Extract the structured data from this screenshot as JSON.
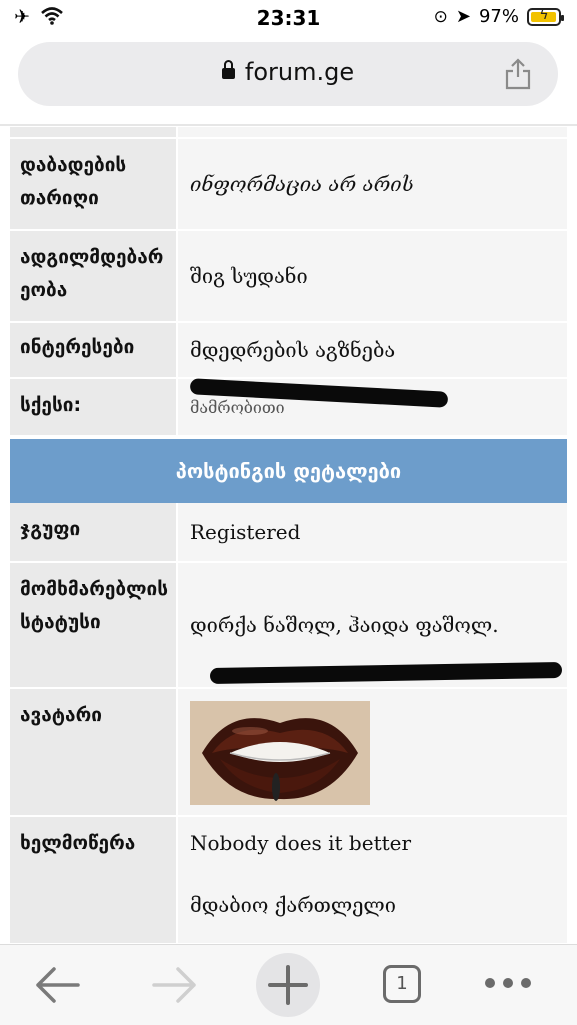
{
  "status_bar": {
    "time": "23:31",
    "battery": "97%",
    "battery_level": 0.97
  },
  "browser": {
    "url": "forum.ge"
  },
  "profile": {
    "birth_date": {
      "label": "დაბადების თარიღი",
      "value": "ინფორმაცია არ არის"
    },
    "location": {
      "label": "ადგილმდებარეობა",
      "value": "შიგ სუდანი"
    },
    "interests": {
      "label": "ინტერესები",
      "value": "მდედრების აგზნება"
    },
    "gender": {
      "label": "სქესი:",
      "value": "მამრობითი"
    }
  },
  "posting_details": {
    "header": "პოსტინგის დეტალები",
    "group": {
      "label": "ჯგუფი",
      "value": "Registered"
    },
    "user_status": {
      "label": "მომხმარებლის სტატუსი",
      "value": "დირქა ნაშოლ, ჰაიდა ფაშოლ."
    },
    "avatar": {
      "label": "ავატარი"
    },
    "signature": {
      "label": "ხელმოწერა",
      "line1": "Nobody does it better",
      "line2": "მდაბიო ქართლელი"
    }
  },
  "toolbar": {
    "tab_count": "1"
  },
  "colors": {
    "banner": "#6d9dcb",
    "label_cell": "#eaeaea",
    "value_cell": "#f5f5f5"
  }
}
